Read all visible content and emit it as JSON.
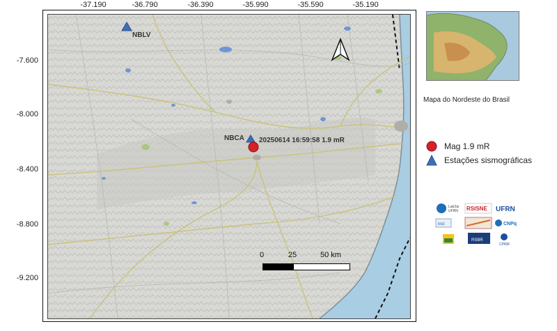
{
  "map": {
    "x_ticks": [
      "-37.190",
      "-36.790",
      "-36.390",
      "-35.990",
      "-35.590",
      "-35.190"
    ],
    "y_ticks": [
      "-7.600",
      "-8.000",
      "-8.400",
      "-8.800",
      "-9.200"
    ],
    "stations": [
      {
        "name": "NBLV"
      },
      {
        "name": "NBCA"
      }
    ],
    "event": {
      "label": "20250614 16:59:58 1.9 mR"
    },
    "scale": {
      "labels": [
        "0",
        "25",
        "50 km"
      ]
    },
    "colors": {
      "event": "#d6202a",
      "station": "#3d6fb8",
      "ocean": "#a9cde3",
      "land": "#d8d8d4"
    }
  },
  "inset": {
    "caption": "Mapa do  Nordeste do Brasil"
  },
  "legend": [
    {
      "symbol": "red-circle",
      "label": "Mag 1.9 mR"
    },
    {
      "symbol": "blue-triangle",
      "label": "Estações sismográficas"
    }
  ],
  "logos": [
    "LabSis UFRN",
    "RSISNE",
    "UFRN",
    "INCT",
    "CNPq",
    "Petrobras",
    "RSBR",
    "CPRM"
  ]
}
